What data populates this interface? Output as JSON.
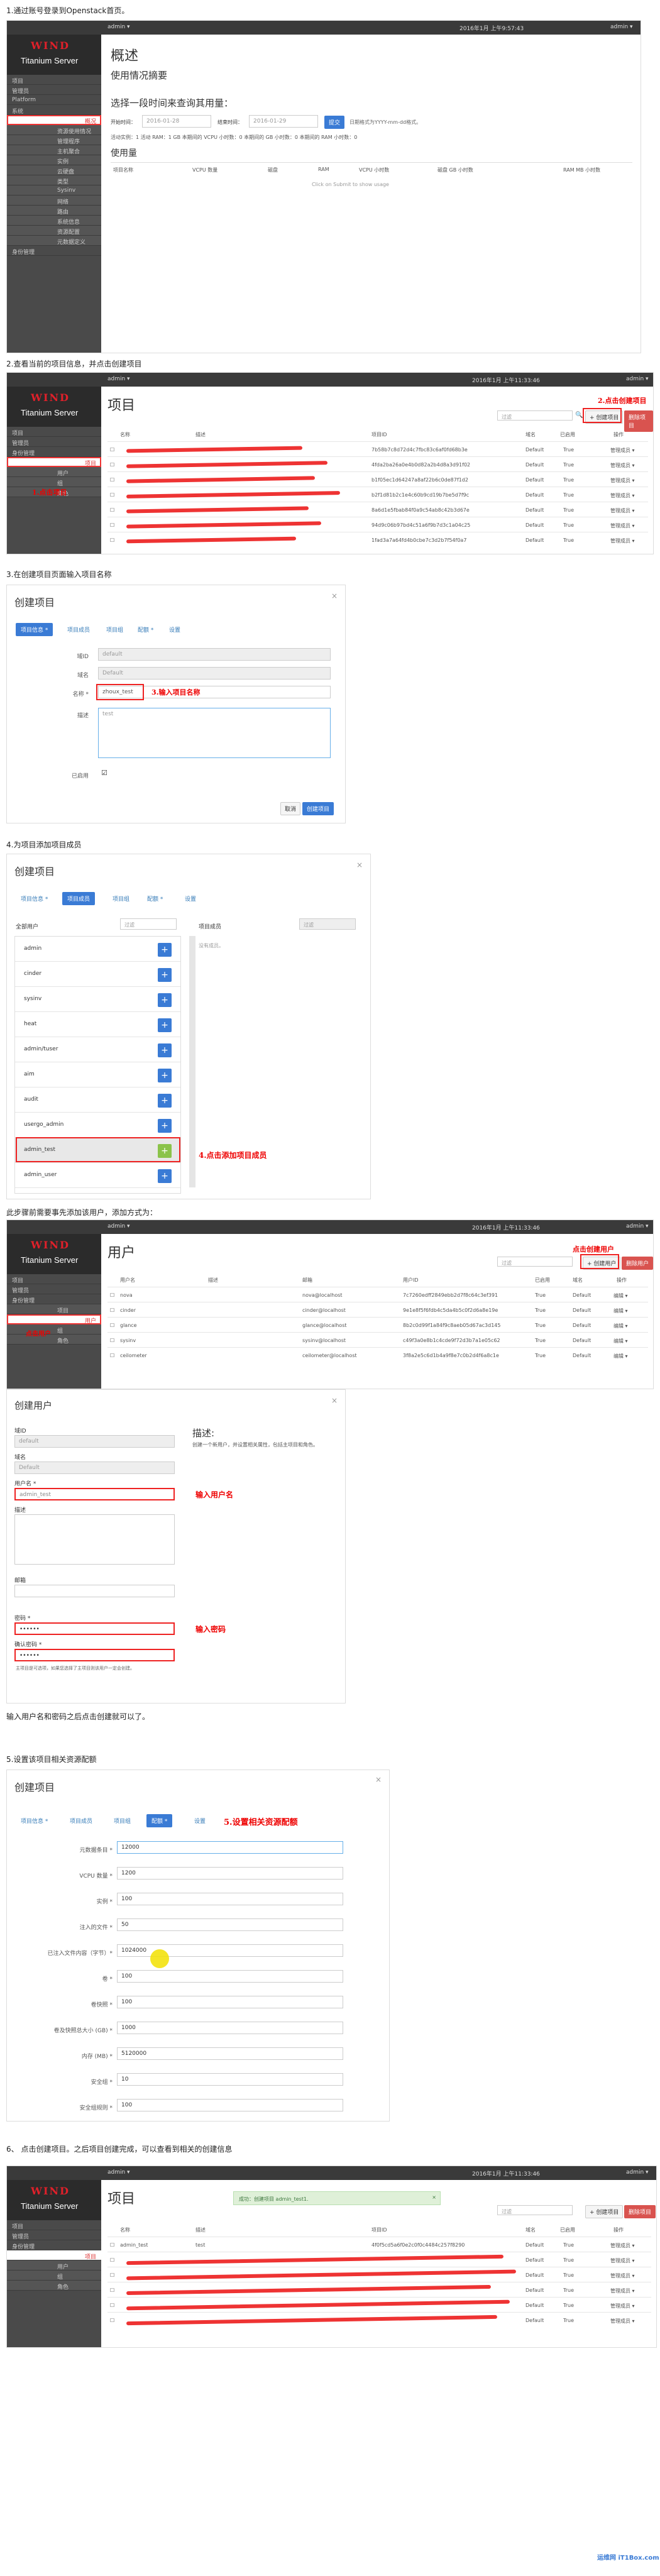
{
  "steps": {
    "s1": "1.通过账号登录到Openstack首页。",
    "s2": "2.查看当前的项目信息，并点击创建项目",
    "s3": "3.在创建项目页面输入项目名称",
    "s4": "4.为项目添加项目成员",
    "s4b": "此步骤前需要事先添加该用户，添加方式为：",
    "s4c": "输入用户名和密码之后点击创建就可以了。",
    "s5": "5.设置该项目相关资源配额",
    "s6": "6、 点击创建项目。之后项目创建完成，可以查看到相关的创建信息"
  },
  "brand": {
    "wind": "WIND",
    "product": "Titanium Server"
  },
  "topbar": {
    "admin": "admin ▾",
    "time1": "2016年1月 上午9:57:43",
    "time2": "2016年1月 上午11:33:46",
    "user": "admin ▾"
  },
  "sidebar": {
    "project": "项目",
    "admin": "管理员",
    "platform": "Platform",
    "system": "系统",
    "identity": "身份管理",
    "overview": "概况",
    "items": [
      "资源使用情况",
      "管理程序",
      "主机聚合",
      "实例",
      "云硬盘",
      "类型",
      "Sysinv",
      "网络",
      "路由",
      "系统信息",
      "资源配置",
      "元数据定义"
    ],
    "projects": "项目",
    "users": "用户",
    "groups": "组",
    "roles": "角色"
  },
  "shot1": {
    "title": "概述",
    "subtitle": "使用情况摘要",
    "period": "选择一段时间来查询其用量：",
    "from_label": "开始时间：",
    "from": "2016-01-28",
    "to_label": "结束时间：",
    "to": "2016-01-29",
    "submit": "提交",
    "hint": "日期格式为YYYY-mm-dd格式。",
    "active": "活动实例：1  活动 RAM：1 GB  本期间的 VCPU 小时数：0  本期间的 GB 小时数：0  本期间的 RAM 小时数：0",
    "usage": "使用量",
    "cols": [
      "项目名称",
      "VCPU 数量",
      "磁盘",
      "RAM",
      "VCPU 小时数",
      "磁盘 GB 小时数",
      "RAM MB 小时数"
    ],
    "empty": "Click on Submit to show usage"
  },
  "shot2": {
    "title": "项目",
    "filter": "过滤",
    "create": "+ 创建项目",
    "delete": "删除项目",
    "annot": "2.点击创建项目",
    "cols": [
      "名称",
      "描述",
      "项目ID",
      "域名",
      "已启用",
      "操作"
    ],
    "rows": [
      {
        "id": "7b58b7c8d72d4c7fbc83c6af0fd68b3e",
        "domain": "Default",
        "enabled": "True"
      },
      {
        "id": "4fda2ba26a0e4b0d82a2b4d8a3d91f02",
        "domain": "Default",
        "enabled": "True"
      },
      {
        "id": "b1f05ec1d64247a8af22b6c0de87f1d2",
        "domain": "Default",
        "enabled": "True"
      },
      {
        "id": "b2f1d81b2c1e4c60b9cd19b7be5d7f9c",
        "domain": "Default",
        "enabled": "True"
      },
      {
        "id": "8a6d1e5fbab84f0a9c54ab8c42b3d67e",
        "domain": "Default",
        "enabled": "True"
      },
      {
        "id": "94d9c06b97bd4c51a6f9b7d3c1a04c25",
        "domain": "Default",
        "enabled": "True"
      },
      {
        "id": "1fad3a7a64fd4b0cbe7c3d2b7f54f0a7",
        "domain": "Default",
        "enabled": "True"
      }
    ],
    "action": "管理成员 ▾",
    "annot_left": "1.点击项目"
  },
  "shot3": {
    "title": "创建项目",
    "tabs": [
      "项目信息 *",
      "项目成员",
      "项目组",
      "配额 *",
      "设置"
    ],
    "domain_id_label": "域ID",
    "domain_id": "default",
    "domain_name_label": "域名",
    "domain_name": "Default",
    "name_label": "名称 *",
    "name": "zhoux_test",
    "annot": "3.输入项目名称",
    "desc_label": "描述",
    "desc_ph": "test",
    "enabled_label": "已启用",
    "cancel": "取消",
    "create": "创建项目"
  },
  "shot4": {
    "title": "创建项目",
    "tabs": [
      "项目信息 *",
      "项目成员",
      "项目组",
      "配额 *",
      "设置"
    ],
    "all_users": "全部用户",
    "filter": "过滤",
    "members": "项目成员",
    "members_filter": "过滤",
    "none": "没有成员。",
    "users": [
      "admin",
      "cinder",
      "sysinv",
      "heat",
      "admin/tuser",
      "aim",
      "audit",
      "usergo_admin",
      "admin_test",
      "admin_user"
    ],
    "annot": "4.点击添加项目成员"
  },
  "shot5": {
    "title": "用户",
    "filter": "过滤",
    "create": "+ 创建用户",
    "delete": "删除用户",
    "annot": "点击创建用户",
    "annot_left": "点击用户",
    "cols": [
      "用户名",
      "描述",
      "邮箱",
      "用户ID",
      "已启用",
      "域名",
      "操作"
    ],
    "rows": [
      {
        "name": "nova",
        "email": "nova@localhost",
        "id": "7c7260edff2849ebb2d7f8c64c3ef391"
      },
      {
        "name": "cinder",
        "email": "cinder@localhost",
        "id": "9e1e8f5f6fdb4c5da4b5c0f2d6a8e19e"
      },
      {
        "name": "glance",
        "email": "glance@localhost",
        "id": "8b2c0d99f1a84f9c8aeb05d67ac3d145"
      },
      {
        "name": "sysinv",
        "email": "sysinv@localhost",
        "id": "c49f3a0e8b1c4cde9f72d3b7a1e05c62"
      },
      {
        "name": "ceilometer",
        "email": "ceilometer@localhost",
        "id": "3f8a2e5c6d1b4a9f8e7c0b2d4f6a8c1e"
      }
    ],
    "enabled": "True",
    "domain": "Default",
    "action": "编辑 ▾"
  },
  "shot6": {
    "title": "创建用户",
    "domain_id_label": "域ID",
    "domain_id": "default",
    "domain_name_label": "域名",
    "domain_name": "Default",
    "user_label": "用户名 *",
    "user": "admin_test",
    "annot_user": "输入用户名",
    "desc_label": "描述",
    "email_label": "邮箱",
    "pwd_label": "密码 *",
    "pwd": "••••••",
    "confirm_label": "确认密码 *",
    "confirm": "••••••",
    "annot_pwd": "输入密码",
    "desc_title": "描述:",
    "desc_text": "创建一个新用户，并设置相关属性，包括主项目和角色。",
    "note": "主项目是可选项，如果您选择了主项目则该用户一定会创建。"
  },
  "shot7": {
    "title": "创建项目",
    "tabs": [
      "项目信息 *",
      "项目成员",
      "项目组",
      "配额 *",
      "设置"
    ],
    "annot": "5.设置相关资源配额",
    "rows": [
      {
        "label": "元数据条目 *",
        "value": "12000"
      },
      {
        "label": "VCPU 数量 *",
        "value": "1200"
      },
      {
        "label": "实例 *",
        "value": "100"
      },
      {
        "label": "注入的文件 *",
        "value": "50"
      },
      {
        "label": "已注入文件内容（字节）*",
        "value": "1024000"
      },
      {
        "label": "卷 *",
        "value": "100"
      },
      {
        "label": "卷快照 *",
        "value": "100"
      },
      {
        "label": "卷及快照总大小 (GB) *",
        "value": "1000"
      },
      {
        "label": "内存 (MB) *",
        "value": "5120000"
      },
      {
        "label": "安全组 *",
        "value": "10"
      },
      {
        "label": "安全组规则 *",
        "value": "100"
      }
    ]
  },
  "shot8": {
    "title": "项目",
    "toast": "成功：创建项目 admin_test1.",
    "filter": "过滤",
    "create": "+ 创建项目",
    "delete": "删除项目",
    "cols": [
      "名称",
      "描述",
      "项目ID",
      "域名",
      "已启用",
      "操作"
    ],
    "first": {
      "name": "admin_test",
      "desc": "test",
      "id": "4f0f5cd5a6f0e2c0f0c4484c257f8290",
      "domain": "Default",
      "enabled": "True"
    },
    "domain": "Default",
    "enabled": "True",
    "action": "管理成员 ▾"
  },
  "watermark": "运维网 iT1Box.com"
}
